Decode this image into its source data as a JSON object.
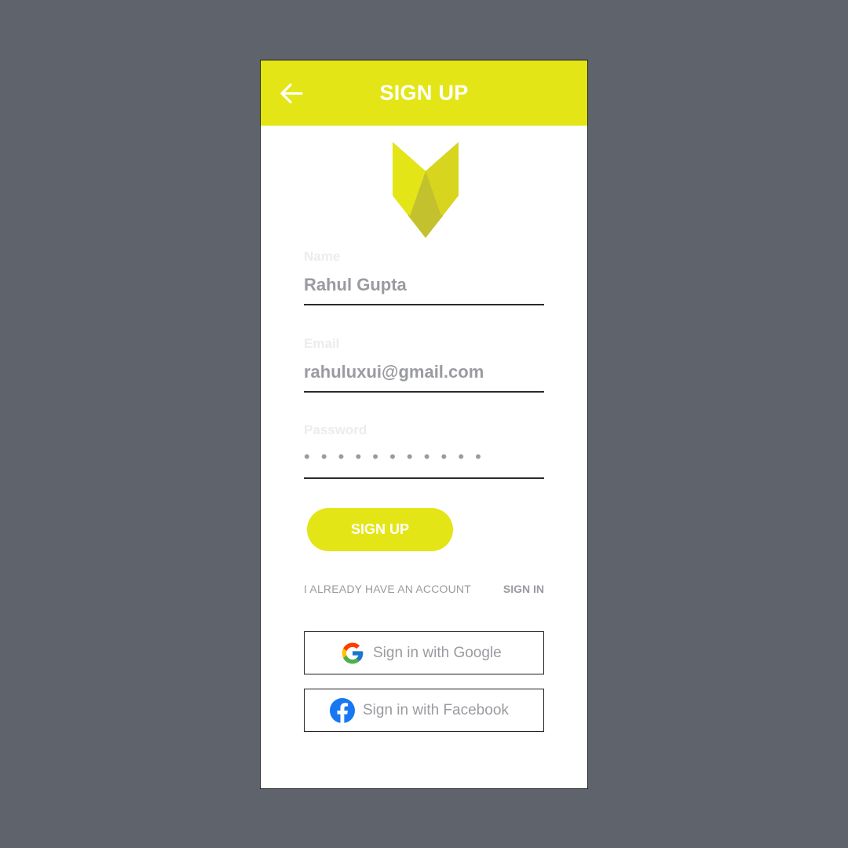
{
  "header": {
    "title": "SIGN UP",
    "back_icon": "arrow-left-icon"
  },
  "logo": {
    "icon": "shield-chevron-logo",
    "color_light": "#e4e516",
    "color_dark": "#c4c12f"
  },
  "form": {
    "name": {
      "label": "Name",
      "value": "Rahul Gupta"
    },
    "email": {
      "label": "Email",
      "value": "rahuluxui@gmail.com"
    },
    "password": {
      "label": "Password",
      "masked_value": "• • • • • • • • • • •"
    }
  },
  "signup_button": {
    "label": "SIGN UP"
  },
  "account": {
    "text": "I ALREADY HAVE AN ACCOUNT",
    "link": "SIGN IN"
  },
  "social": {
    "google": {
      "label": "Sign in with Google",
      "icon": "google-icon"
    },
    "facebook": {
      "label": "Sign in with Facebook",
      "icon": "facebook-icon"
    }
  },
  "colors": {
    "accent": "#e4e516",
    "background": "#5f636b",
    "text_muted": "#9a9ba0",
    "label": "#ececee"
  }
}
